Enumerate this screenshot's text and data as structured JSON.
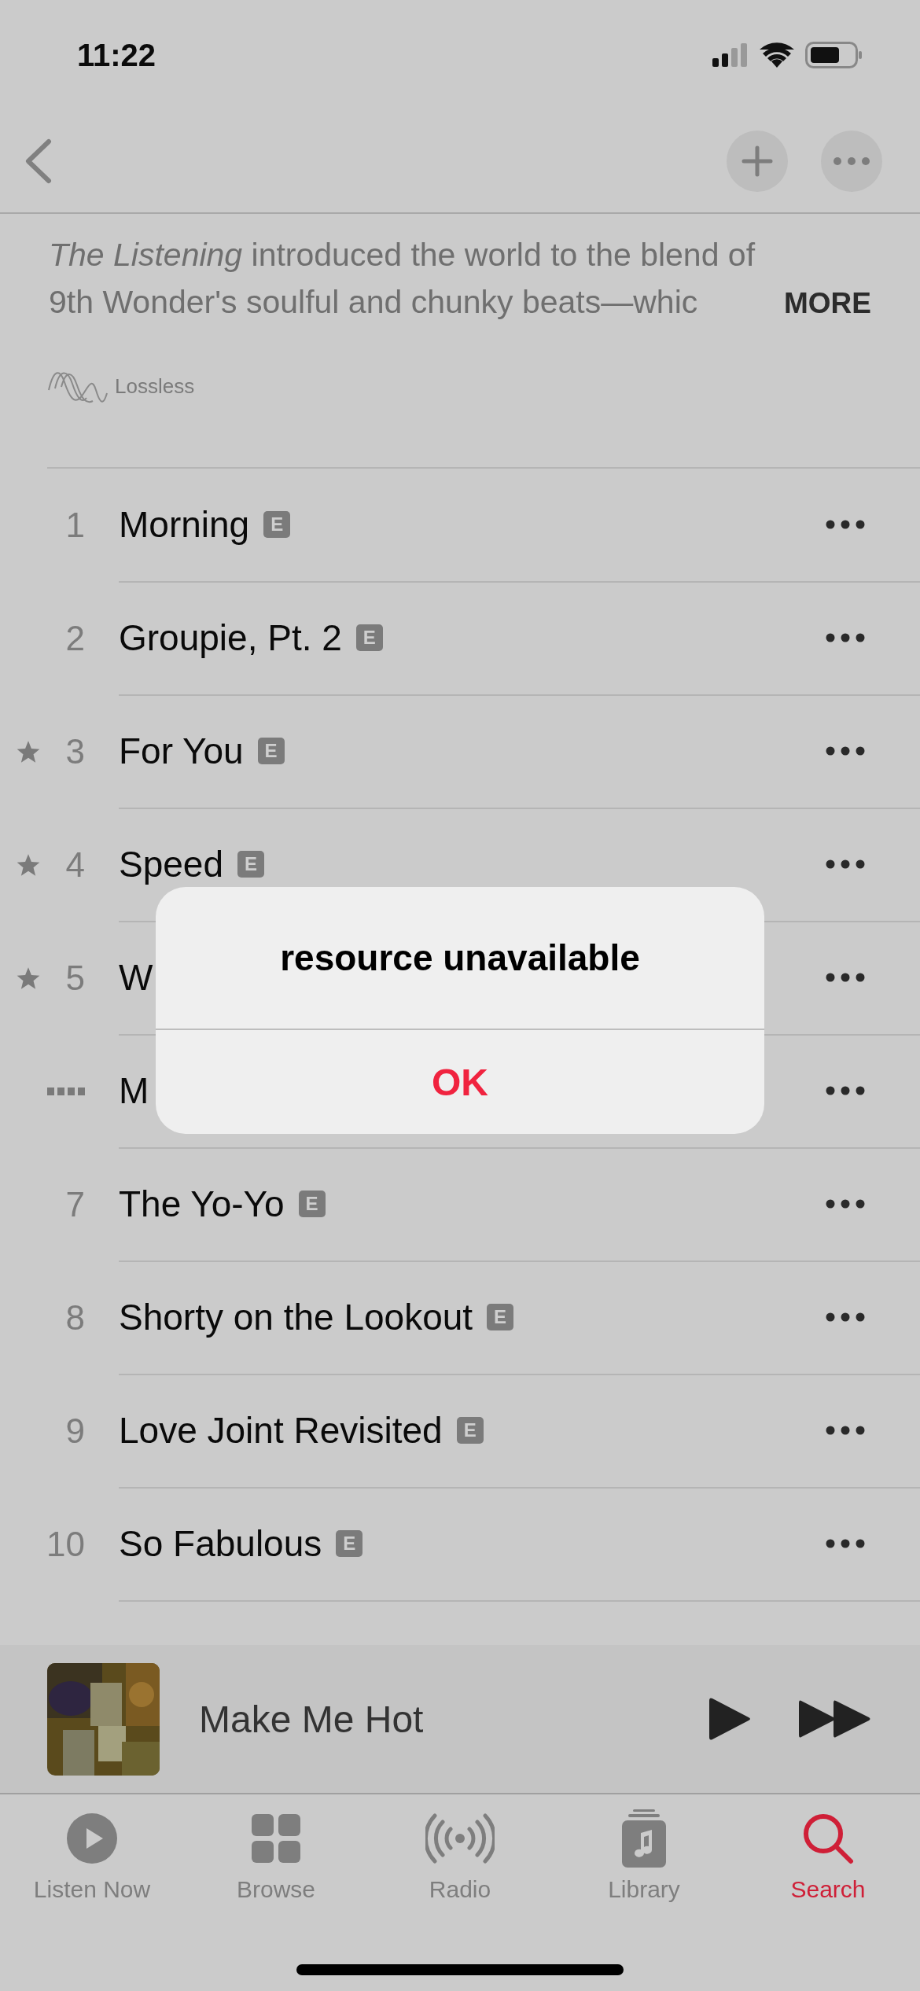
{
  "status_bar": {
    "time": "11:22"
  },
  "description": {
    "lines": [
      "*The Listening* introduced the world to the blend of",
      "9th Wonder's soulful and chunky beats—whic"
    ],
    "more": "MORE"
  },
  "badge": {
    "label": "Lossless"
  },
  "tracks": [
    {
      "kind": "number",
      "number": "1",
      "title": "Morning",
      "badge": "E",
      "starred": false
    },
    {
      "kind": "number",
      "number": "2",
      "title": "Groupie, Pt. 2",
      "badge": "E",
      "starred": false
    },
    {
      "kind": "number",
      "number": "3",
      "title": "For You",
      "badge": "E",
      "starred": true
    },
    {
      "kind": "number",
      "number": "4",
      "title": "Speed",
      "badge": "E",
      "starred": true
    },
    {
      "kind": "number",
      "number": "5",
      "title": "W",
      "starred": true
    },
    {
      "kind": "playing",
      "title": "M",
      "starred": false
    },
    {
      "kind": "number",
      "number": "7",
      "title": "The Yo-Yo",
      "badge": "E",
      "starred": false
    },
    {
      "kind": "number",
      "number": "8",
      "title": "Shorty on the Lookout",
      "badge": "E",
      "starred": false
    },
    {
      "kind": "number",
      "number": "9",
      "title": "Love Joint Revisited",
      "badge": "E",
      "starred": false
    },
    {
      "kind": "number",
      "number": "10",
      "title": "So Fabulous",
      "badge": "E",
      "starred": false
    }
  ],
  "mini_player": {
    "title": "Make Me Hot"
  },
  "tabs": [
    {
      "label": "Listen Now",
      "selected": false
    },
    {
      "label": "Browse",
      "selected": false
    },
    {
      "label": "Radio",
      "selected": false
    },
    {
      "label": "Library",
      "selected": false
    },
    {
      "label": "Search",
      "selected": true
    }
  ],
  "alert": {
    "title": "resource unavailable",
    "button": "OK"
  }
}
